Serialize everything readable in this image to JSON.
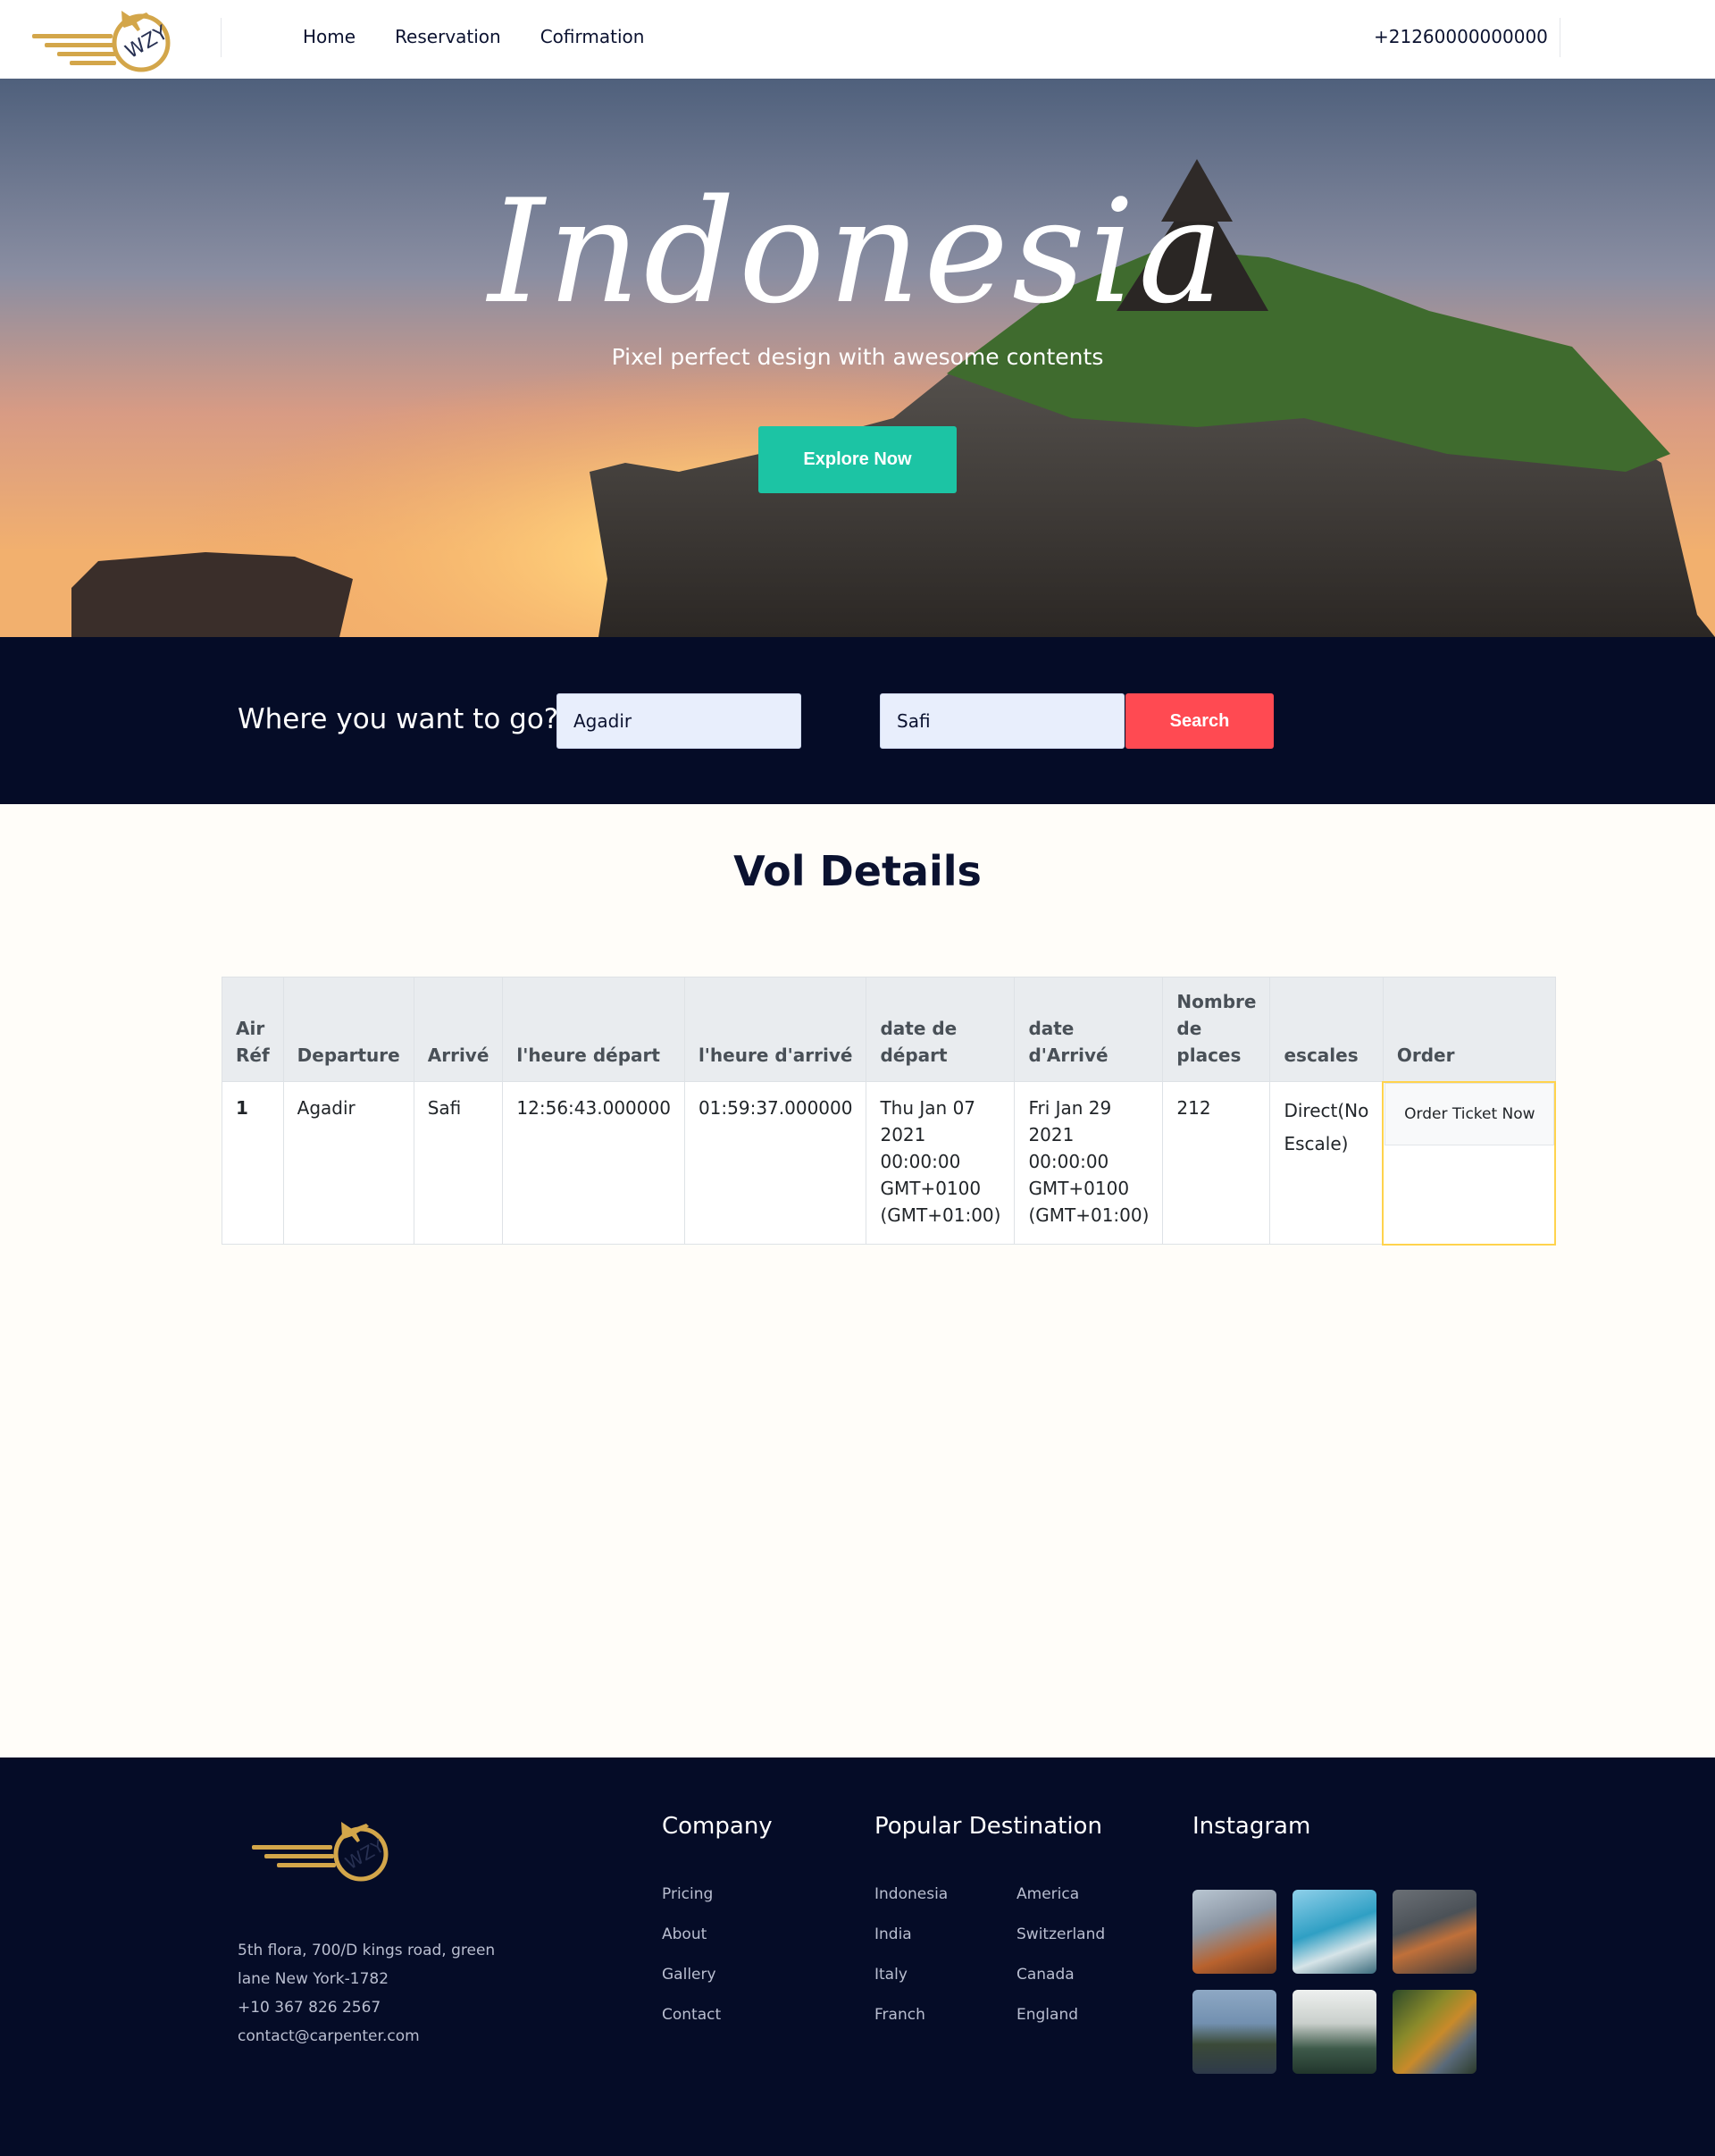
{
  "header": {
    "logo_text": "WZY",
    "nav": [
      "Home",
      "Reservation",
      "Cofirmation"
    ],
    "phone": "+21260000000000"
  },
  "hero": {
    "title": "Indonesia",
    "subtitle": "Pixel perfect design with awesome contents",
    "cta_label": "Explore Now"
  },
  "search": {
    "prompt": "Where you want to go?",
    "from_value": "Agadir",
    "to_value": "Safi",
    "button_label": "Search"
  },
  "vol": {
    "title": "Vol Details",
    "headers": [
      "Air Réf",
      "Departure",
      "Arrivé",
      "l'heure départ",
      "l'heure d'arrivé",
      "date de départ",
      "date d'Arrivé",
      "Nombre de places",
      "escales",
      "Order"
    ],
    "row": {
      "ref": "1",
      "departure": "Agadir",
      "arrive": "Safi",
      "heure_depart": "12:56:43.000000",
      "heure_arrive": "01:59:37.000000",
      "date_depart": "Thu Jan 07 2021 00:00:00 GMT+0100 (GMT+01:00)",
      "date_arrive": "Fri Jan 29 2021 00:00:00 GMT+0100 (GMT+01:00)",
      "places": "212",
      "escales": "Direct(No Escale)",
      "order_label": "Order Ticket Now"
    }
  },
  "footer": {
    "address_lines": [
      "5th flora, 700/D kings road, green",
      "lane New York-1782",
      "+10 367 826 2567",
      "contact@carpenter.com"
    ],
    "company_title": "Company",
    "company_links": [
      "Pricing",
      "About",
      "Gallery",
      "Contact"
    ],
    "destination_title": "Popular Destination",
    "destinations_col1": [
      "Indonesia",
      "India",
      "Italy",
      "Franch"
    ],
    "destinations_col2": [
      "America",
      "Switzerland",
      "Canada",
      "England"
    ],
    "instagram_title": "Instagram"
  },
  "colors": {
    "navy": "#050c27",
    "teal": "#1cc4a4",
    "red": "#ff4a52",
    "gold": "#d3a64a"
  }
}
